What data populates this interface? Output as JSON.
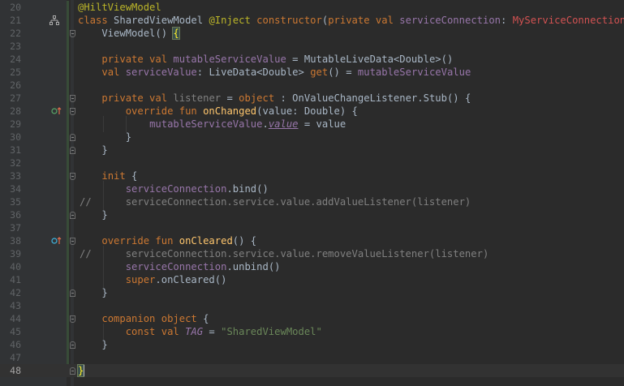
{
  "editor": {
    "colors": {
      "background": "#2b2b2b",
      "gutter": "#313335",
      "keyword": "#cc7832",
      "annotation": "#bbb529",
      "property": "#9876aa",
      "function": "#ffc66d",
      "string": "#6a8759",
      "error_type": "#d25252",
      "comment": "#808080",
      "vcs_added": "#384c38",
      "vcs_modified": "#374752"
    },
    "gutter_icons": {
      "line_21": "hierarchy-icon",
      "line_28": "override-implements-icon",
      "line_38": "overrides-icon"
    },
    "lines": [
      {
        "n": "20",
        "tokens": [
          [
            "ann",
            "@HiltViewModel"
          ]
        ]
      },
      {
        "n": "21",
        "tokens": [
          [
            "kw",
            "class "
          ],
          [
            "txt",
            "SharedViewModel "
          ],
          [
            "ann",
            "@Inject "
          ],
          [
            "kw",
            "constructor"
          ],
          [
            "txt",
            "("
          ],
          [
            "kw",
            "private val "
          ],
          [
            "prop",
            "serviceConnection"
          ],
          [
            "txt",
            ": "
          ],
          [
            "err",
            "MyServiceConnection"
          ],
          [
            "txt",
            ") :"
          ]
        ]
      },
      {
        "n": "22",
        "tokens": [
          [
            "txt",
            "    ViewModel() "
          ],
          [
            "brace",
            "{"
          ]
        ]
      },
      {
        "n": "23",
        "tokens": []
      },
      {
        "n": "24",
        "tokens": [
          [
            "txt",
            "    "
          ],
          [
            "kw",
            "private val "
          ],
          [
            "prop",
            "mutableServiceValue"
          ],
          [
            "txt",
            " = MutableLiveData<Double>()"
          ]
        ]
      },
      {
        "n": "25",
        "tokens": [
          [
            "txt",
            "    "
          ],
          [
            "kw",
            "val "
          ],
          [
            "prop",
            "serviceValue"
          ],
          [
            "txt",
            ": LiveData<Double> "
          ],
          [
            "kw",
            "get"
          ],
          [
            "txt",
            "() = "
          ],
          [
            "prop",
            "mutableServiceValue"
          ]
        ]
      },
      {
        "n": "26",
        "tokens": []
      },
      {
        "n": "27",
        "tokens": [
          [
            "txt",
            "    "
          ],
          [
            "kw",
            "private val "
          ],
          [
            "cmt",
            "listener"
          ],
          [
            "txt",
            " = "
          ],
          [
            "kw",
            "object"
          ],
          [
            "txt",
            " : OnValueChangeListener.Stub() {"
          ]
        ]
      },
      {
        "n": "28",
        "tokens": [
          [
            "txt",
            "        "
          ],
          [
            "kw",
            "override fun "
          ],
          [
            "fn",
            "onChanged"
          ],
          [
            "txt",
            "(value: Double) {"
          ]
        ]
      },
      {
        "n": "29",
        "tokens": [
          [
            "txt",
            "            "
          ],
          [
            "prop",
            "mutableServiceValue"
          ],
          [
            "txt",
            "."
          ],
          [
            "ivalue",
            "value"
          ],
          [
            "txt",
            " = value"
          ]
        ]
      },
      {
        "n": "30",
        "tokens": [
          [
            "txt",
            "        }"
          ]
        ]
      },
      {
        "n": "31",
        "tokens": [
          [
            "txt",
            "    }"
          ]
        ]
      },
      {
        "n": "32",
        "tokens": []
      },
      {
        "n": "33",
        "tokens": [
          [
            "txt",
            "    "
          ],
          [
            "kw",
            "init "
          ],
          [
            "txt",
            "{"
          ]
        ]
      },
      {
        "n": "34",
        "tokens": [
          [
            "txt",
            "        "
          ],
          [
            "prop",
            "serviceConnection"
          ],
          [
            "txt",
            ".bind()"
          ]
        ]
      },
      {
        "n": "35",
        "comment_prefix": "//",
        "tokens": [
          [
            "cmt",
            "        serviceConnection.service.value.addValueListener(listener)"
          ]
        ]
      },
      {
        "n": "36",
        "tokens": [
          [
            "txt",
            "    }"
          ]
        ]
      },
      {
        "n": "37",
        "tokens": []
      },
      {
        "n": "38",
        "tokens": [
          [
            "txt",
            "    "
          ],
          [
            "kw",
            "override fun "
          ],
          [
            "fn",
            "onCleared"
          ],
          [
            "txt",
            "() {"
          ]
        ]
      },
      {
        "n": "39",
        "comment_prefix": "//",
        "tokens": [
          [
            "cmt",
            "        serviceConnection.service.value.removeValueListener(listener)"
          ]
        ]
      },
      {
        "n": "40",
        "tokens": [
          [
            "txt",
            "        "
          ],
          [
            "prop",
            "serviceConnection"
          ],
          [
            "txt",
            ".unbind()"
          ]
        ]
      },
      {
        "n": "41",
        "tokens": [
          [
            "txt",
            "        "
          ],
          [
            "kw",
            "super"
          ],
          [
            "txt",
            ".onCleared()"
          ]
        ]
      },
      {
        "n": "42",
        "tokens": [
          [
            "txt",
            "    }"
          ]
        ]
      },
      {
        "n": "43",
        "tokens": []
      },
      {
        "n": "44",
        "tokens": [
          [
            "txt",
            "    "
          ],
          [
            "kw",
            "companion object "
          ],
          [
            "txt",
            "{"
          ]
        ]
      },
      {
        "n": "45",
        "tokens": [
          [
            "txt",
            "        "
          ],
          [
            "kw",
            "const val "
          ],
          [
            "iconst",
            "TAG"
          ],
          [
            "txt",
            " = "
          ],
          [
            "str",
            "\"SharedViewModel\""
          ]
        ]
      },
      {
        "n": "46",
        "tokens": [
          [
            "txt",
            "    }"
          ]
        ]
      },
      {
        "n": "47",
        "tokens": []
      },
      {
        "n": "48",
        "current": true,
        "tokens": [
          [
            "brace",
            "}"
          ]
        ]
      }
    ]
  }
}
